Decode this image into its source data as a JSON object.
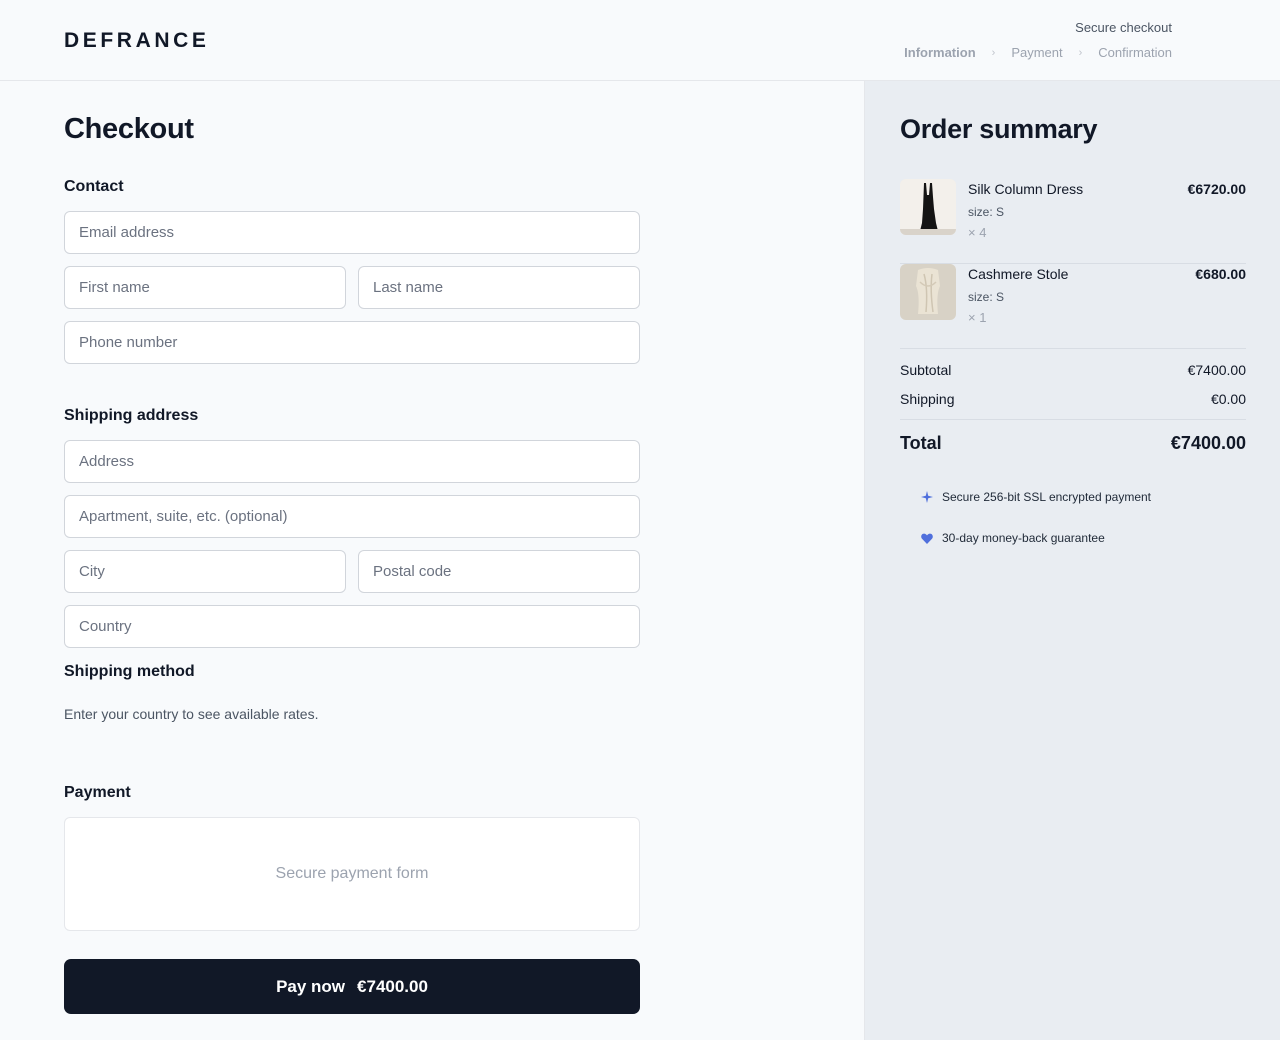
{
  "header": {
    "logo": "DEFRANCE",
    "secure_label": "Secure checkout",
    "steps": [
      {
        "label": "Information"
      },
      {
        "label": "Payment"
      },
      {
        "label": "Confirmation"
      }
    ],
    "separator": "›"
  },
  "checkout": {
    "title": "Checkout",
    "contact": {
      "title": "Contact",
      "email": {
        "placeholder": "Email address",
        "value": ""
      },
      "first_name": {
        "placeholder": "First name",
        "value": ""
      },
      "last_name": {
        "placeholder": "Last name",
        "value": ""
      },
      "phone": {
        "placeholder": "Phone number",
        "value": ""
      }
    },
    "shipping_address": {
      "title": "Shipping address",
      "address": {
        "placeholder": "Address",
        "value": ""
      },
      "apartment": {
        "placeholder": "Apartment, suite, etc. (optional)",
        "value": ""
      },
      "city": {
        "placeholder": "City",
        "value": ""
      },
      "postal_code": {
        "placeholder": "Postal code",
        "value": ""
      },
      "country": {
        "placeholder": "Country",
        "value": ""
      }
    },
    "shipping_method": {
      "title": "Shipping method",
      "note": "Enter your country to see available rates."
    },
    "payment": {
      "title": "Payment",
      "placeholder": "Secure payment form"
    },
    "pay_button": {
      "label": "Pay now",
      "amount": "€7400.00"
    }
  },
  "summary": {
    "title": "Order summary",
    "items": [
      {
        "name": "Silk Column Dress",
        "size": "size: S",
        "qty": "× 4",
        "price": "€6720.00",
        "image": "black-silk-dress-photo"
      },
      {
        "name": "Cashmere Stole",
        "size": "size: S",
        "qty": "× 1",
        "price": "€680.00",
        "image": "cream-cashmere-stole-photo"
      }
    ],
    "subtotal": {
      "label": "Subtotal",
      "value": "€7400.00"
    },
    "shipping": {
      "label": "Shipping",
      "value": "€0.00"
    },
    "total": {
      "label": "Total",
      "value": "€7400.00"
    },
    "badges": [
      {
        "icon": "sparkle-icon",
        "text": "Secure 256-bit SSL encrypted payment"
      },
      {
        "icon": "heart-icon",
        "text": "30-day money-back guarantee"
      }
    ]
  },
  "colors": {
    "accent": "#111827",
    "badge_icon": "#4f6fdc",
    "summary_bg": "#e9edf2",
    "page_bg": "#f8fafc"
  }
}
